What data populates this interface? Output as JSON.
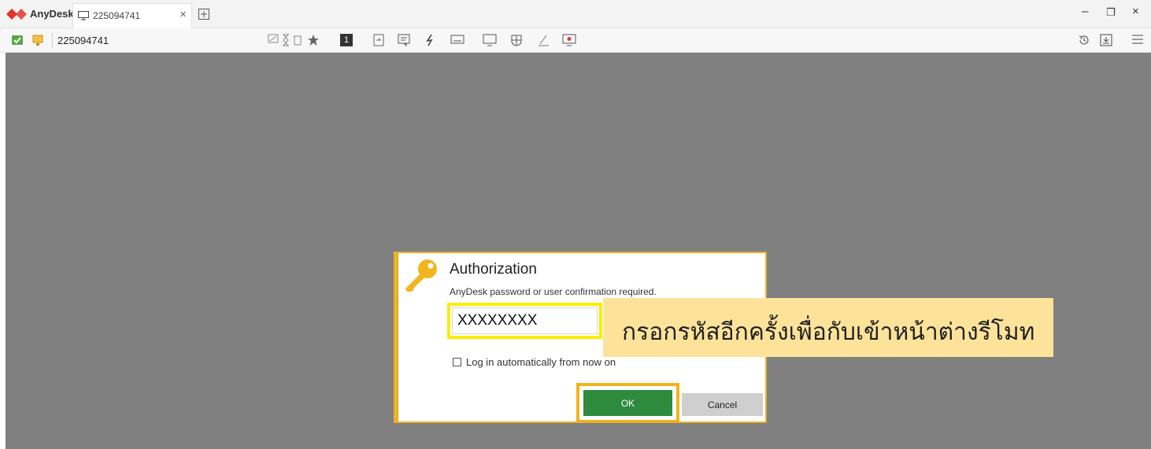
{
  "titlebar": {
    "brand": "AnyDesk",
    "tab_label": "225094741",
    "tab_close": "×",
    "win_min": "–",
    "win_restore": "❐",
    "win_close": "×"
  },
  "toolbar": {
    "address": "225094741",
    "icons": [
      "remote-status-icon",
      "desk-icon",
      "monitor-stats-icon",
      "hourglass-icon",
      "bin-icon",
      "star-icon",
      "display-1-icon",
      "file-transfer-icon",
      "chat-icon",
      "actions-icon",
      "keyboard-icon",
      "display-icon",
      "permissions-icon",
      "whiteboard-icon",
      "record-icon",
      "history-icon",
      "download-icon",
      "menu-icon"
    ],
    "display_number": "1"
  },
  "dialog": {
    "title": "Authorization",
    "subtitle": "AnyDesk password or user confirmation required.",
    "password_value": "XXXXXXXX",
    "checkbox_label": "Log in automatically from now on",
    "ok_label": "OK",
    "cancel_label": "Cancel"
  },
  "annotation": {
    "text": "กรอกรหัสอีกครั้งเพื่อกับเข้าหน้าต่างรีโมท"
  },
  "colors": {
    "accent": "#f2b51d",
    "ok_green": "#2e8b3d",
    "highlight_yellow": "#ffeb00",
    "callout_bg": "#fde39a",
    "remote_bg": "#808080"
  }
}
